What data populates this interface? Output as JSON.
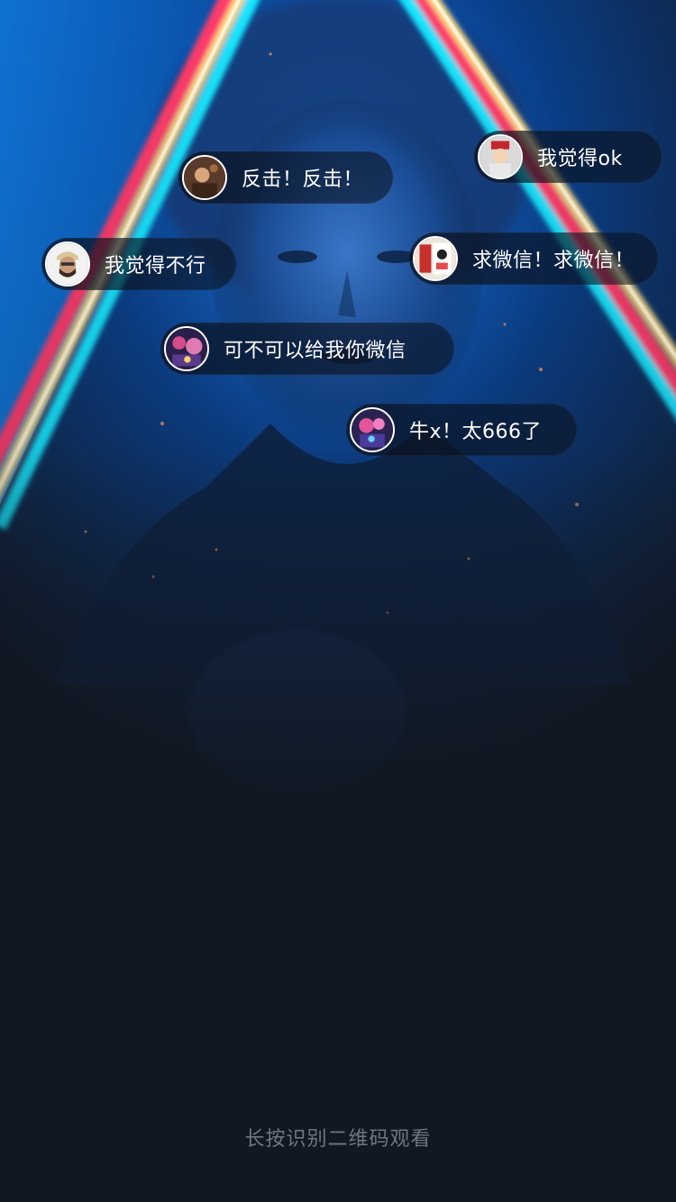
{
  "comments": [
    {
      "avatar": "avatar-photo-1",
      "text": "我觉得ok"
    },
    {
      "avatar": "avatar-photo-2",
      "text": "反击！反击！"
    },
    {
      "avatar": "avatar-photo-3",
      "text": "我觉得不行"
    },
    {
      "avatar": "avatar-photo-4",
      "text": "求微信！求微信！"
    },
    {
      "avatar": "avatar-photo-5",
      "text": "可不可以给我你微信"
    },
    {
      "avatar": "avatar-photo-6",
      "text": "牛x！太666了"
    }
  ],
  "footer": {
    "hint": "长按识别二维码观看"
  },
  "colors": {
    "background": "#111823",
    "neon_cyan": "#19e6ff",
    "neon_red": "#ff3b6b",
    "neon_yellow": "#ffe08a",
    "scene_blue": "#0a6ad6"
  }
}
